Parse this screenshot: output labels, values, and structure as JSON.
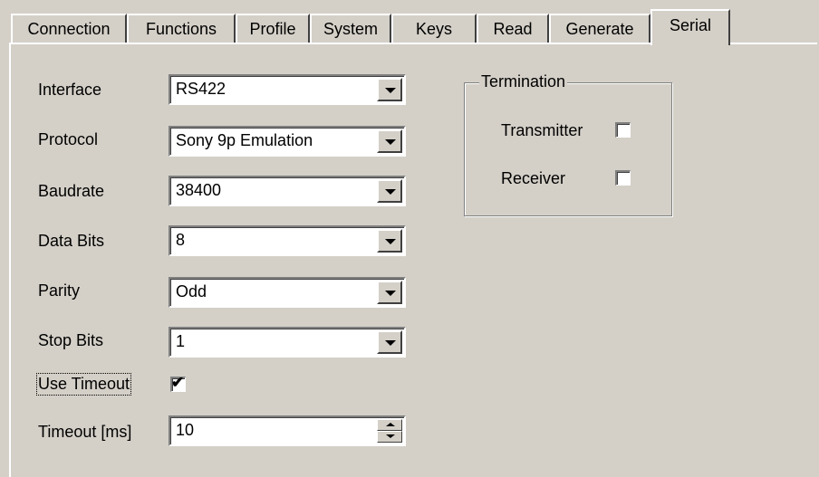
{
  "tabs": [
    {
      "label": "Connection"
    },
    {
      "label": "Functions"
    },
    {
      "label": "Profile"
    },
    {
      "label": "System"
    },
    {
      "label": "Keys"
    },
    {
      "label": "Read"
    },
    {
      "label": "Generate"
    },
    {
      "label": "Serial"
    }
  ],
  "active_tab": "Serial",
  "form": {
    "interface": {
      "label": "Interface",
      "value": "RS422"
    },
    "protocol": {
      "label": "Protocol",
      "value": "Sony 9p Emulation"
    },
    "baudrate": {
      "label": "Baudrate",
      "value": "38400"
    },
    "data_bits": {
      "label": "Data Bits",
      "value": "8"
    },
    "parity": {
      "label": "Parity",
      "value": "Odd"
    },
    "stop_bits": {
      "label": "Stop Bits",
      "value": "1"
    },
    "use_timeout": {
      "label": "Use Timeout",
      "checked": true
    },
    "timeout": {
      "label": "Timeout [ms]",
      "value": "10"
    }
  },
  "termination": {
    "title": "Termination",
    "transmitter": {
      "label": "Transmitter",
      "checked": false
    },
    "receiver": {
      "label": "Receiver",
      "checked": false
    }
  },
  "glyphs": {
    "check": "✔"
  }
}
